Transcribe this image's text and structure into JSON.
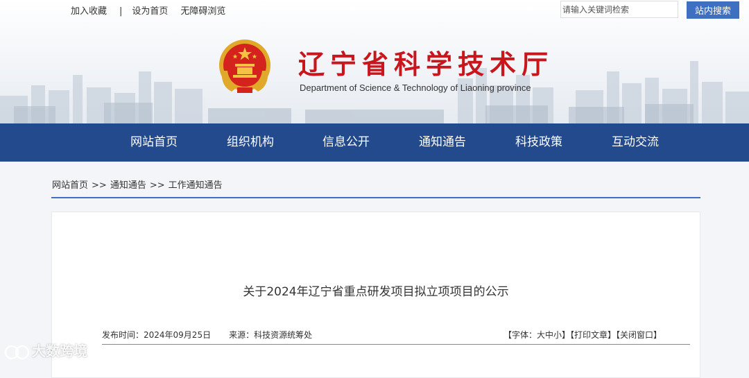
{
  "top_links": [
    "加入收藏",
    "|",
    "设为首页",
    "无障碍浏览"
  ],
  "search": {
    "placeholder": "请输入关键词检索",
    "button": "站内搜索"
  },
  "site": {
    "title": "辽宁省科学技术厅",
    "subtitle": "Department of Science & Technology of Liaoning province"
  },
  "nav": [
    "网站首页",
    "组织机构",
    "信息公开",
    "通知通告",
    "科技政策",
    "互动交流"
  ],
  "breadcrumb": [
    "网站首页",
    "通知通告",
    "工作通知通告"
  ],
  "breadcrumb_separator": ">>",
  "article": {
    "title": "关于2024年辽宁省重点研发项目拟立项项目的公示",
    "date": "发布时间：2024年09月25日",
    "source": "来源：科技资源统筹处",
    "tools": "【字体：大中小】【打印文章】【关闭窗口】"
  },
  "watermark": "大数跨境",
  "colors": {
    "nav": "#234a8c",
    "accent": "#3f6fc1",
    "title": "#c8161d"
  },
  "icons": [
    "national-emblem-icon",
    "watermark-logo-icon"
  ]
}
